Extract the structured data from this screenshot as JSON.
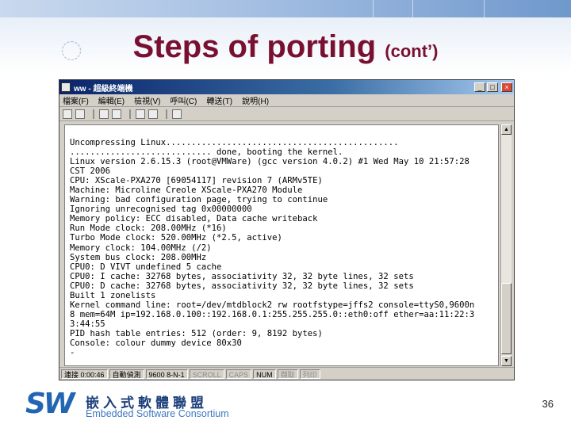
{
  "slide": {
    "title": "Steps of porting",
    "title_suffix": "(cont’)",
    "page_number": "36"
  },
  "window": {
    "title": "ww - 超級終端機",
    "controls": {
      "minimize": "_",
      "maximize": "□",
      "close": "×"
    },
    "menu": [
      "檔案(F)",
      "編輯(E)",
      "檢視(V)",
      "呼叫(C)",
      "轉送(T)",
      "說明(H)"
    ],
    "status": [
      "連接 0:00:46",
      "自動偵測",
      "9600 8-N-1",
      "SCROLL",
      "CAPS",
      "NUM",
      "擷取",
      "列印"
    ]
  },
  "console_lines": [
    "Uncompressing Linux..............................................",
    "............................ done, booting the kernel.",
    "Linux version 2.6.15.3 (root@VMWare) (gcc version 4.0.2) #1 Wed May 10 21:57:28",
    "CST 2006",
    "CPU: XScale-PXA270 [69054117] revision 7 (ARMv5TE)",
    "Machine: Microline Creole XScale-PXA270 Module",
    "Warning: bad configuration page, trying to continue",
    "Ignoring unrecognised tag 0x00000000",
    "Memory policy: ECC disabled, Data cache writeback",
    "Run Mode clock: 208.00MHz (*16)",
    "Turbo Mode clock: 520.00MHz (*2.5, active)",
    "Memory clock: 104.00MHz (/2)",
    "System bus clock: 208.00MHz",
    "CPU0: D VIVT undefined 5 cache",
    "CPU0: I cache: 32768 bytes, associativity 32, 32 byte lines, 32 sets",
    "CPU0: D cache: 32768 bytes, associativity 32, 32 byte lines, 32 sets",
    "Built 1 zonelists",
    "Kernel command line: root=/dev/mtdblock2 rw rootfstype=jffs2 console=ttyS0,9600n",
    "8 mem=64M ip=192.168.0.100::192.168.0.1:255.255.255.0::eth0:off ether=aa:11:22:3",
    "3:44:55",
    "PID hash table entries: 512 (order: 9, 8192 bytes)",
    "Console: colour dummy device 80x30",
    "-"
  ],
  "logo": {
    "mark": "SW",
    "name_cn": "嵌入式軟體聯盟",
    "name_en": "Embedded Software Consortium"
  },
  "colors": {
    "title": "#7a1030",
    "titlebar": "#0a246a",
    "logo_blue": "#2266b3"
  },
  "icons": [
    "app-icon",
    "new-icon",
    "open-icon",
    "connect-icon",
    "disconnect-icon",
    "send-icon",
    "properties-icon"
  ]
}
